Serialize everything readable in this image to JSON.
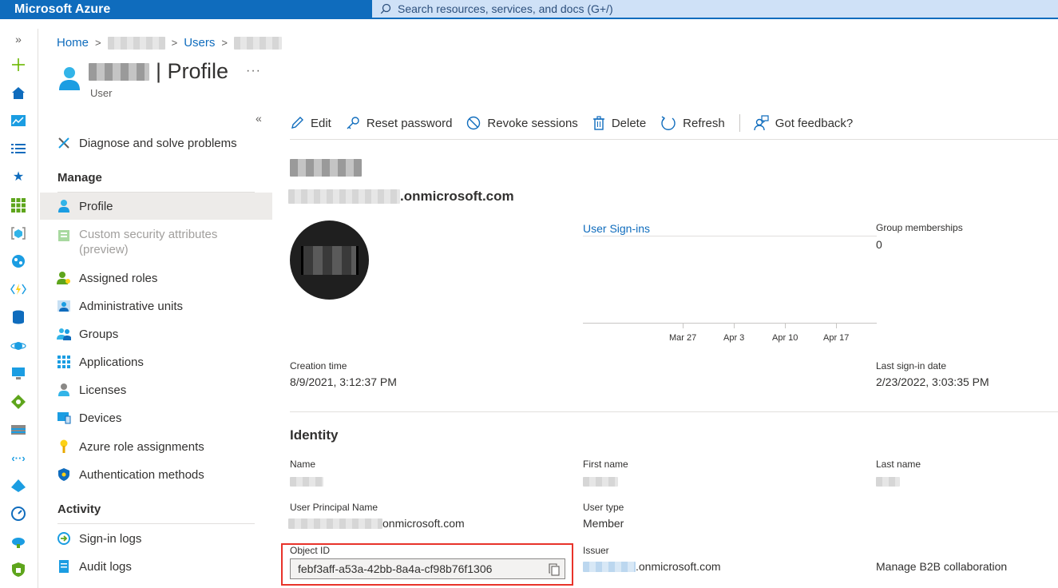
{
  "app": {
    "brand": "Microsoft Azure"
  },
  "search": {
    "placeholder": "Search resources, services, and docs (G+/)"
  },
  "breadcrumb": {
    "home": "Home",
    "users": "Users"
  },
  "page": {
    "title": "| Profile",
    "subtitle": "User",
    "more": "···"
  },
  "nav": {
    "diagnose": "Diagnose and solve problems",
    "manage_heading": "Manage",
    "profile": "Profile",
    "custom_security_line1": "Custom security attributes",
    "custom_security_line2": "(preview)",
    "assigned_roles": "Assigned roles",
    "administrative_units": "Administrative units",
    "groups": "Groups",
    "applications": "Applications",
    "licenses": "Licenses",
    "devices": "Devices",
    "azure_role_assignments": "Azure role assignments",
    "authentication_methods": "Authentication methods",
    "activity_heading": "Activity",
    "signin_logs": "Sign-in logs",
    "audit_logs": "Audit logs"
  },
  "toolbar": {
    "edit": "Edit",
    "reset_password": "Reset password",
    "revoke_sessions": "Revoke sessions",
    "delete": "Delete",
    "refresh": "Refresh",
    "feedback": "Got feedback?"
  },
  "profile": {
    "upn_suffix": ".onmicrosoft.com",
    "signins_link": "User Sign-ins",
    "group_memberships_label": "Group memberships",
    "group_memberships_value": "0",
    "creation_time_label": "Creation time",
    "creation_time_value": "8/9/2021, 3:12:37 PM",
    "last_signin_label": "Last sign-in date",
    "last_signin_value": "2/23/2022, 3:03:35 PM"
  },
  "chart_ticks": [
    "Mar 27",
    "Apr 3",
    "Apr 10",
    "Apr 17"
  ],
  "identity": {
    "heading": "Identity",
    "name_label": "Name",
    "first_name_label": "First name",
    "last_name_label": "Last name",
    "upn_label": "User Principal Name",
    "upn_value_suffix": "onmicrosoft.com",
    "user_type_label": "User type",
    "user_type_value": "Member",
    "object_id_label": "Object ID",
    "object_id_value": "febf3aff-a53a-42bb-8a4a-cf98b76f1306",
    "issuer_label": "Issuer",
    "issuer_value_suffix": ".onmicrosoft.com",
    "manage_b2b": "Manage B2B collaboration"
  },
  "colors": {
    "azure_blue": "#0f6cbd",
    "highlight_red": "#e8332a"
  }
}
